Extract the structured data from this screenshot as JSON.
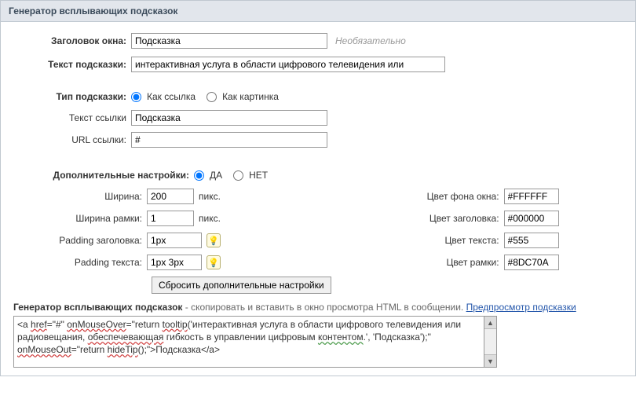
{
  "header": {
    "title": "Генератор всплывающих подсказок"
  },
  "form": {
    "win_title_label": "Заголовок окна:",
    "win_title_value": "Подсказка",
    "optional_text": "Необязательно",
    "tip_text_label": "Текст подсказки:",
    "tip_text_value": "интерактивная услуга в области цифрового телевидения или",
    "tip_type_label": "Тип подсказки:",
    "radio_link": "Как ссылка",
    "radio_image": "Как картинка",
    "link_text_label": "Текст ссылки",
    "link_text_value": "Подсказка",
    "link_url_label": "URL ссылки:",
    "link_url_value": "#",
    "adv_label": "Дополнительные настройки:",
    "radio_yes": "ДА",
    "radio_no": "НЕТ",
    "width_label": "Ширина:",
    "width_value": "200",
    "border_width_label": "Ширина рамки:",
    "border_width_value": "1",
    "px_unit": "пикс.",
    "pad_title_label": "Padding заголовка:",
    "pad_title_value": "1px",
    "pad_text_label": "Padding текста:",
    "pad_text_value": "1px 3px",
    "bg_color_label": "Цвет фона окна:",
    "bg_color_value": "#FFFFFF",
    "title_color_label": "Цвет заголовка:",
    "title_color_value": "#000000",
    "text_color_label": "Цвет текста:",
    "text_color_value": "#555",
    "border_color_label": "Цвет рамки:",
    "border_color_value": "#8DC70A",
    "reset_button": "Сбросить дополнительные настройки"
  },
  "output": {
    "label_bold": "Генератор всплывающих подсказок",
    "label_rest": " - скопировать и вставить в окно просмотра HTML в сообщении. ",
    "preview_link": "Предпросмотр подсказки",
    "code_plain": "<a href=\"#\" onMouseOver=\"return tooltip('интерактивная услуга в области цифрового телевидения или радиовещания, обеспечевающая гибкость в управлении цифровым контентом.', 'Подсказка');\" onMouseOut=\"return hideTip();\">Подсказка</a>"
  }
}
